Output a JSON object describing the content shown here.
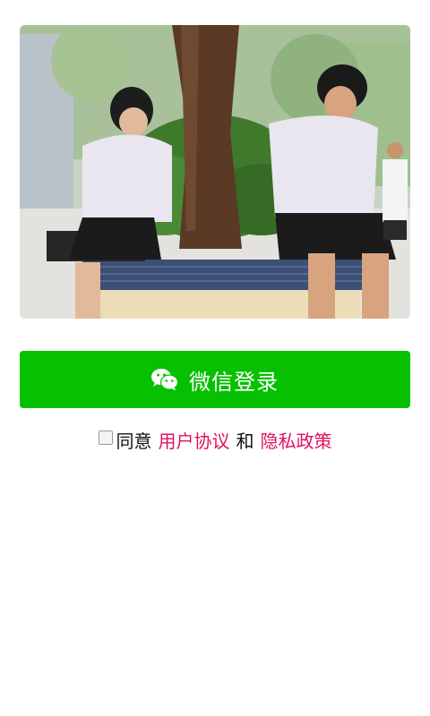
{
  "hero": {
    "image_alt": "two students in school uniforms sitting on a tiled bench around a tree"
  },
  "login": {
    "wechat_label": "微信登录",
    "icon": "wechat-icon",
    "color": "#07c001"
  },
  "agreement": {
    "checked": false,
    "prefix": "同意",
    "user_agreement": "用户协议",
    "and": "和",
    "privacy_policy": "隐私政策",
    "link_color": "#e0115f"
  }
}
